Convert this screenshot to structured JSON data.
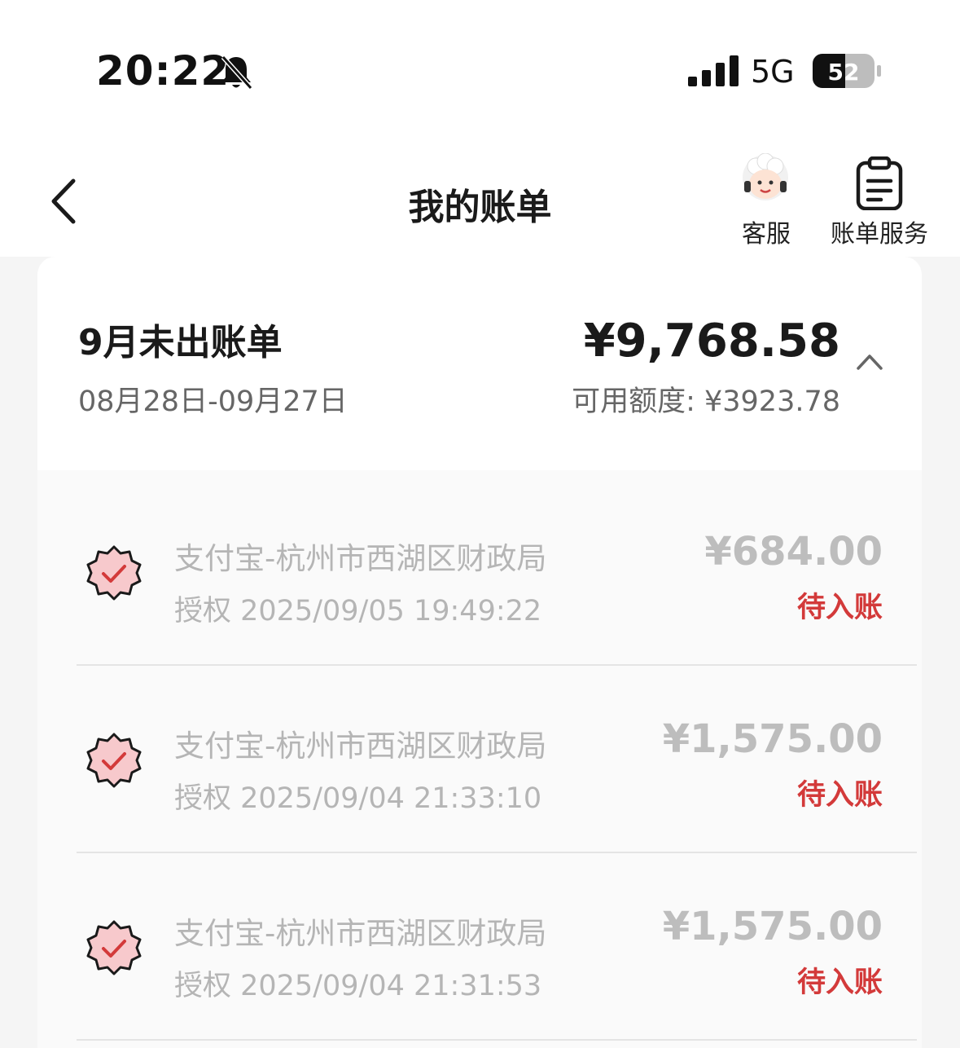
{
  "status_bar": {
    "time": "20:22",
    "network": "5G",
    "battery": "52"
  },
  "nav": {
    "title": "我的账单",
    "customer_service_label": "客服",
    "bill_service_label": "账单服务"
  },
  "summary": {
    "period_title": "9月未出账单",
    "date_range": "08月28日-09月27日",
    "total_amount": "¥9,768.58",
    "available_credit": "可用额度: ¥3923.78"
  },
  "transactions": [
    {
      "merchant": "支付宝-杭州市西湖区财政局",
      "auth_time": "授权 2025/09/05 19:49:22",
      "amount": "¥684.00",
      "status": "待入账"
    },
    {
      "merchant": "支付宝-杭州市西湖区财政局",
      "auth_time": "授权 2025/09/04 21:33:10",
      "amount": "¥1,575.00",
      "status": "待入账"
    },
    {
      "merchant": "支付宝-杭州市西湖区财政局",
      "auth_time": "授权 2025/09/04 21:31:53",
      "amount": "¥1,575.00",
      "status": "待入账"
    }
  ],
  "colors": {
    "accent_red": "#d33a3a",
    "muted_text": "#b5b5b5"
  },
  "icons": {
    "back": "chevron-left-icon",
    "customer_service": "customer-service-avatar-icon",
    "bill_service": "clipboard-icon",
    "collapse": "chevron-up-icon",
    "transaction": "verified-badge-icon"
  }
}
